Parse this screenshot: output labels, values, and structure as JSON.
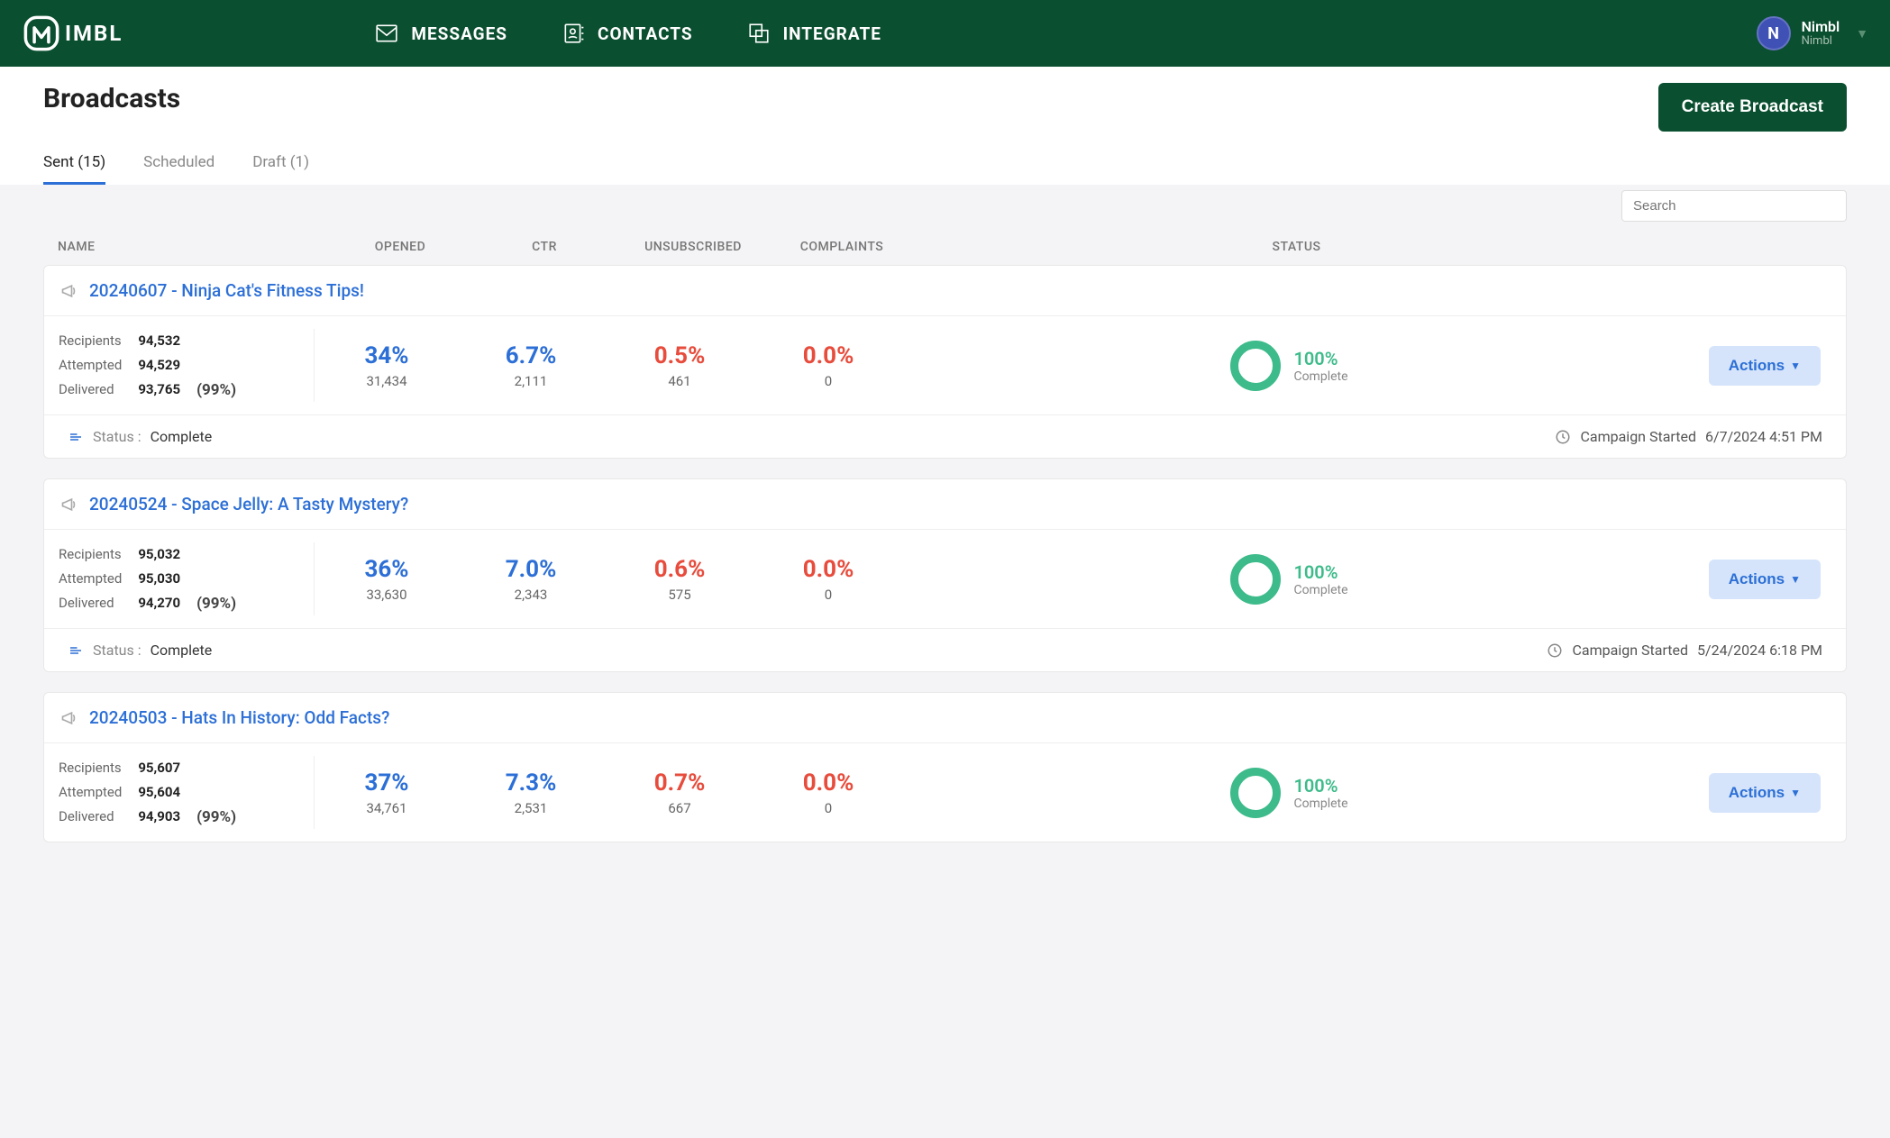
{
  "brand": {
    "name": "IMBL"
  },
  "nav": {
    "messages": "MESSAGES",
    "contacts": "CONTACTS",
    "integrate": "INTEGRATE"
  },
  "user": {
    "avatar_letter": "N",
    "name": "Nimbl",
    "org": "Nimbl"
  },
  "page": {
    "title": "Broadcasts",
    "create_button": "Create Broadcast"
  },
  "tabs": {
    "sent": "Sent (15)",
    "scheduled": "Scheduled",
    "draft": "Draft (1)"
  },
  "search": {
    "placeholder": "Search"
  },
  "columns": {
    "name": "NAME",
    "opened": "OPENED",
    "ctr": "CTR",
    "unsubscribed": "UNSUBSCRIBED",
    "complaints": "COMPLAINTS",
    "status": "STATUS"
  },
  "labels": {
    "recipients": "Recipients",
    "attempted": "Attempted",
    "delivered": "Delivered",
    "status": "Status :",
    "campaign_started": "Campaign Started",
    "actions": "Actions",
    "complete": "Complete"
  },
  "broadcasts": [
    {
      "name": "20240607 - Ninja Cat's Fitness Tips!",
      "recipients": "94,532",
      "attempted": "94,529",
      "delivered": "93,765",
      "delivered_pct": "(99%)",
      "opened_pct": "34%",
      "opened_n": "31,434",
      "ctr_pct": "6.7%",
      "ctr_n": "2,111",
      "unsub_pct": "0.5%",
      "unsub_n": "461",
      "complaints_pct": "0.0%",
      "complaints_n": "0",
      "status_pct": "100%",
      "status": "Complete",
      "started": "6/7/2024 4:51 PM"
    },
    {
      "name": "20240524 - Space Jelly: A Tasty Mystery?",
      "recipients": "95,032",
      "attempted": "95,030",
      "delivered": "94,270",
      "delivered_pct": "(99%)",
      "opened_pct": "36%",
      "opened_n": "33,630",
      "ctr_pct": "7.0%",
      "ctr_n": "2,343",
      "unsub_pct": "0.6%",
      "unsub_n": "575",
      "complaints_pct": "0.0%",
      "complaints_n": "0",
      "status_pct": "100%",
      "status": "Complete",
      "started": "5/24/2024 6:18 PM"
    },
    {
      "name": "20240503 - Hats In History: Odd Facts?",
      "recipients": "95,607",
      "attempted": "95,604",
      "delivered": "94,903",
      "delivered_pct": "(99%)",
      "opened_pct": "37%",
      "opened_n": "34,761",
      "ctr_pct": "7.3%",
      "ctr_n": "2,531",
      "unsub_pct": "0.7%",
      "unsub_n": "667",
      "complaints_pct": "0.0%",
      "complaints_n": "0",
      "status_pct": "100%",
      "status": "Complete",
      "started": ""
    }
  ]
}
